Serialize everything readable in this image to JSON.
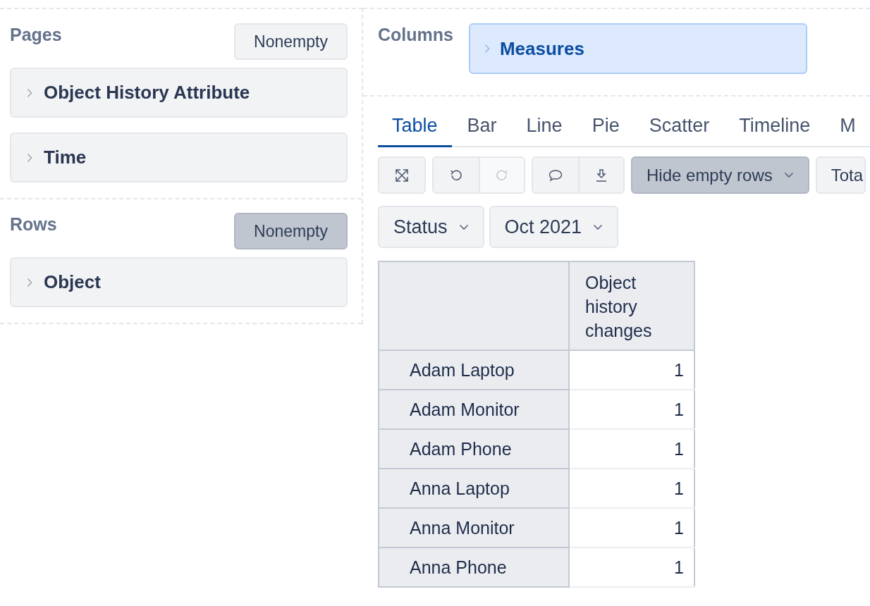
{
  "pages": {
    "title": "Pages",
    "nonempty": {
      "label": "Nonempty",
      "selected": false
    },
    "items": [
      {
        "label": "Object History Attribute"
      },
      {
        "label": "Time"
      }
    ]
  },
  "rows": {
    "title": "Rows",
    "nonempty": {
      "label": "Nonempty",
      "selected": true
    },
    "items": [
      {
        "label": "Object"
      }
    ]
  },
  "columns": {
    "title": "Columns",
    "items": [
      {
        "label": "Measures"
      }
    ]
  },
  "tabs": [
    {
      "label": "Table",
      "selected": true
    },
    {
      "label": "Bar",
      "selected": false
    },
    {
      "label": "Line",
      "selected": false
    },
    {
      "label": "Pie",
      "selected": false
    },
    {
      "label": "Scatter",
      "selected": false
    },
    {
      "label": "Timeline",
      "selected": false
    },
    {
      "label": "M",
      "selected": false
    }
  ],
  "toolbar": {
    "icon_buttons": [
      {
        "disabled": false
      },
      {
        "disabled": false
      },
      {
        "disabled": true
      },
      {
        "disabled": false
      },
      {
        "disabled": false
      }
    ],
    "hide_empty": {
      "label": "Hide empty rows",
      "selected": true
    },
    "totals": {
      "label": "Tota"
    }
  },
  "filters": [
    {
      "label": "Status"
    },
    {
      "label": "Oct 2021"
    }
  ],
  "table": {
    "column_header": "Object history changes",
    "rows": [
      {
        "label": "Adam Laptop",
        "value": "1"
      },
      {
        "label": "Adam Monitor",
        "value": "1"
      },
      {
        "label": "Adam Phone",
        "value": "1"
      },
      {
        "label": "Anna Laptop",
        "value": "1"
      },
      {
        "label": "Anna Monitor",
        "value": "1"
      },
      {
        "label": "Anna Phone",
        "value": "1"
      }
    ]
  }
}
